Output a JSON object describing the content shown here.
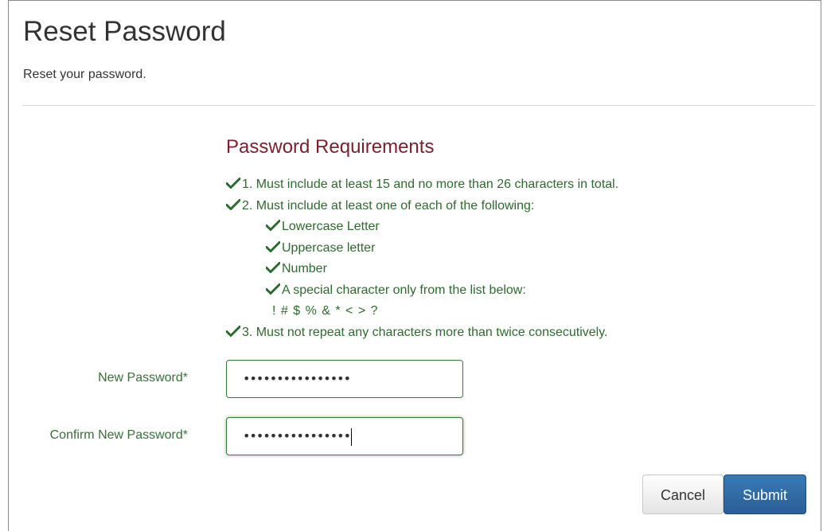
{
  "page": {
    "title": "Reset Password",
    "subtitle": "Reset your password."
  },
  "requirements": {
    "title": "Password Requirements",
    "items": [
      "1. Must include at least 15 and no more than 26 characters in total.",
      "2. Must include at least one of each of the following:"
    ],
    "sub_items": [
      "Lowercase Letter",
      "Uppercase letter",
      "Number",
      "A special character only from the list below:"
    ],
    "special_chars": "! # $ % & * < > ?",
    "last_item": "3. Must not repeat any characters more than twice consecutively.",
    "check_icon": "checkmark-icon"
  },
  "form": {
    "new_password": {
      "label": "New Password*",
      "value": "••••••••••••••••"
    },
    "confirm_password": {
      "label": "Confirm New Password*",
      "value": "••••••••••••••••"
    }
  },
  "buttons": {
    "cancel": "Cancel",
    "submit": "Submit"
  },
  "colors": {
    "requirements_title": "#7a1f2e",
    "requirement_text": "#2d6a2d",
    "field_border": "#3c763d",
    "submit_button": "#2a5f94"
  }
}
